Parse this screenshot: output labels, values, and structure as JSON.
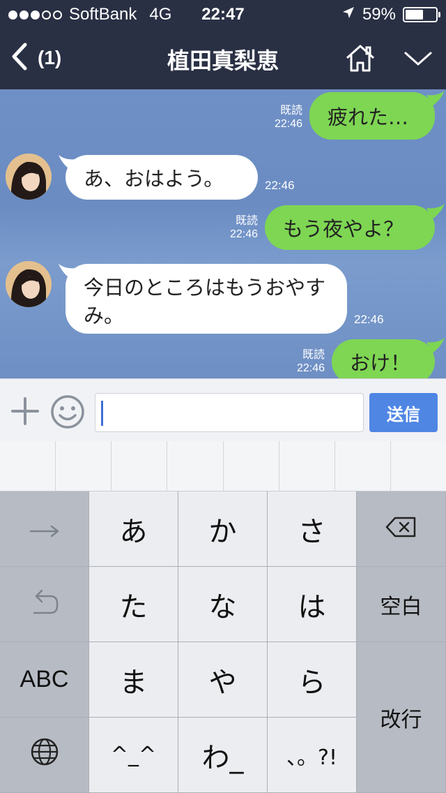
{
  "status_bar": {
    "signal_dots": [
      true,
      true,
      true,
      false,
      false
    ],
    "carrier": "SoftBank",
    "network": "4G",
    "time": "22:47",
    "location_icon": "location-arrow-icon",
    "battery_percent": "59%",
    "battery_level": 0.59
  },
  "nav": {
    "back_icon": "chevron-left-icon",
    "unread_count": "(1)",
    "title": "植田真梨恵",
    "home_icon": "home-icon",
    "menu_icon": "chevron-down-icon"
  },
  "messages": [
    {
      "side": "me",
      "text": "疲れた…",
      "read": "既読",
      "time": "22:46"
    },
    {
      "side": "them",
      "text": "あ、おはよう。",
      "time": "22:46"
    },
    {
      "side": "me",
      "text": "もう夜やよ？",
      "read": "既読",
      "time": "22:46"
    },
    {
      "side": "them",
      "text": "今日のところはもうおやすみ。",
      "time": "22:46"
    },
    {
      "side": "me",
      "text": "おけ！",
      "read": "既読",
      "time": "22:46"
    }
  ],
  "input": {
    "plus_icon": "plus-icon",
    "emoji_icon": "smiley-icon",
    "value": "",
    "send_label": "送信"
  },
  "keyboard": {
    "left_column": [
      {
        "icon": "arrow-right-icon"
      },
      {
        "icon": "undo-icon"
      },
      {
        "label": "ABC"
      },
      {
        "icon": "globe-icon"
      }
    ],
    "kana_keys": [
      "あ",
      "か",
      "さ",
      "た",
      "な",
      "は",
      "ま",
      "や",
      "ら",
      "^_^",
      "わ_",
      "、。?!"
    ],
    "right_column": {
      "delete_icon": "backspace-icon",
      "space_label": "空白",
      "return_label": "改行"
    }
  },
  "colors": {
    "header_bg": "#2a3044",
    "my_bubble": "#7ed653",
    "their_bubble": "#ffffff",
    "send_button": "#4f86e4"
  }
}
